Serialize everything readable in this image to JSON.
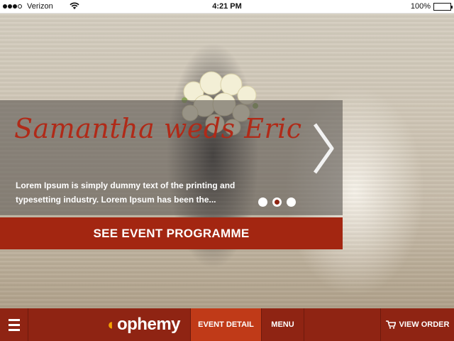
{
  "status_bar": {
    "carrier": "Verizon",
    "time": "4:21 PM",
    "battery": "100%",
    "battery_level": 1.0,
    "signal_bars": 3,
    "signal_total": 4
  },
  "hero": {
    "title": "Samantha weds Eric",
    "description": "Lorem Ipsum is simply dummy text of the printing and typesetting industry. Lorem Ipsum has been the...",
    "next_icon": "chevron-right-icon",
    "slides": 3,
    "active_slide": 2,
    "cta_label": "SEE EVENT PROGRAMME",
    "accent_color": "#a32611",
    "title_color": "#b02a18"
  },
  "bottom_nav": {
    "menu_icon": "hamburger-icon",
    "logo": "ophemy",
    "tabs": [
      {
        "label": "EVENT DETAIL",
        "active": true
      },
      {
        "label": "MENU",
        "active": false
      }
    ],
    "view_order_label": "VIEW ORDER",
    "cart_icon": "cart-icon",
    "bar_color": "#8f2413",
    "active_color": "#c03a18",
    "logo_accent": "#f5a300"
  }
}
